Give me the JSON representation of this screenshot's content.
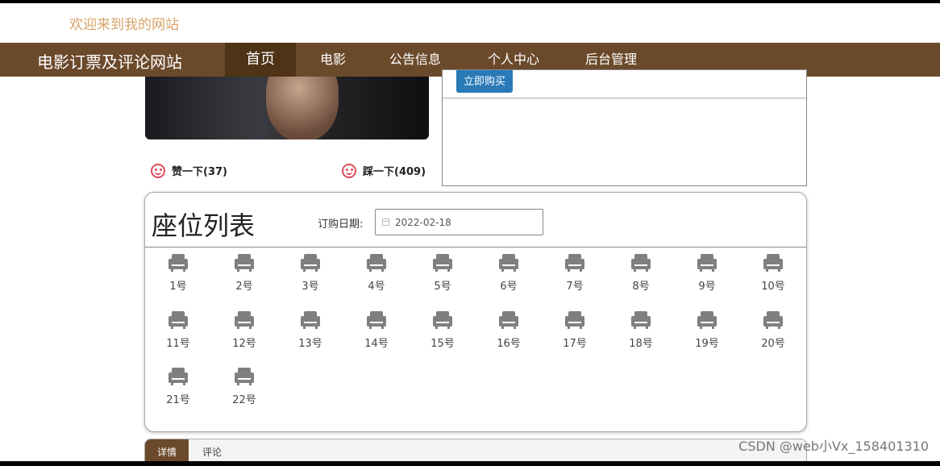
{
  "header": {
    "welcome": "欢迎来到我的网站"
  },
  "navbar": {
    "brand": "电影订票及评论网站",
    "items": [
      {
        "label": "首页",
        "active": true
      },
      {
        "label": "电影",
        "active": false
      },
      {
        "label": "公告信息",
        "active": false
      },
      {
        "label": "个人中心",
        "active": false
      },
      {
        "label": "后台管理",
        "active": false
      }
    ]
  },
  "movie": {
    "buy_button": "立即购买",
    "like_label": "赞一下(37)",
    "dislike_label": "踩一下(409)"
  },
  "seats": {
    "title": "座位列表",
    "date_label": "订购日期:",
    "date_value": "2022-02-18",
    "list": [
      "1号",
      "2号",
      "3号",
      "4号",
      "5号",
      "6号",
      "7号",
      "8号",
      "9号",
      "10号",
      "11号",
      "12号",
      "13号",
      "14号",
      "15号",
      "16号",
      "17号",
      "18号",
      "19号",
      "20号",
      "21号",
      "22号"
    ]
  },
  "tabs": [
    {
      "label": "详情",
      "active": true
    },
    {
      "label": "评论",
      "active": false
    }
  ],
  "watermark": "CSDN @web小Vx_158401310",
  "colors": {
    "nav_bg": "#6b4a2b",
    "nav_active": "#4e3317",
    "welcome": "#d9a46a",
    "buy_button": "#2a7ab8",
    "smile": "#e04a5a"
  },
  "icons": {
    "seat": "armchair-icon",
    "vote": "smiley-icon",
    "date": "calendar-icon"
  }
}
